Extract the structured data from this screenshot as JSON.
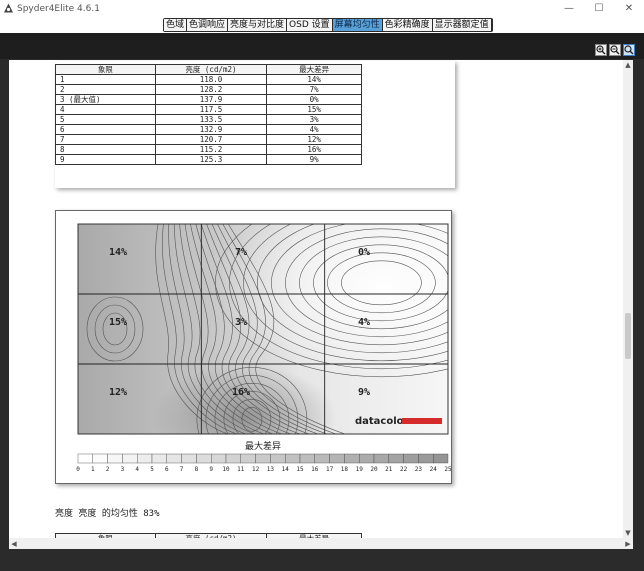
{
  "window": {
    "title": "Spyder4Elite 4.6.1",
    "minimize": "—",
    "maximize": "☐",
    "close": "✕"
  },
  "tabs": [
    {
      "label": "色域",
      "active": false
    },
    {
      "label": "色调响应",
      "active": false
    },
    {
      "label": "亮度与对比度",
      "active": false
    },
    {
      "label": "OSD 设置",
      "active": false
    },
    {
      "label": "屏幕均匀性",
      "active": true
    },
    {
      "label": "色彩精确度",
      "active": false
    },
    {
      "label": "显示器额定值",
      "active": false
    }
  ],
  "zoom": {
    "zoom_in": "zoom-in-icon",
    "zoom_out": "zoom-out-icon",
    "zoom_fit": "zoom-fit-icon"
  },
  "table1": {
    "headers": [
      "象限",
      "亮度 (cd/m2)",
      "最大差异"
    ],
    "rows": [
      [
        "1",
        "118.0",
        "14%"
      ],
      [
        "2",
        "128.2",
        "7%"
      ],
      [
        "3 (最大值)",
        "137.9",
        "0%"
      ],
      [
        "4",
        "117.5",
        "15%"
      ],
      [
        "5",
        "133.5",
        "3%"
      ],
      [
        "6",
        "132.9",
        "4%"
      ],
      [
        "7",
        "120.7",
        "12%"
      ],
      [
        "8",
        "115.2",
        "16%"
      ],
      [
        "9",
        "125.3",
        "9%"
      ]
    ]
  },
  "chart_data": {
    "type": "heatmap",
    "grid": "3x3",
    "cells": [
      "14%",
      "7%",
      "0%",
      "15%",
      "3%",
      "4%",
      "12%",
      "16%",
      "9%"
    ],
    "values": [
      14,
      7,
      0,
      15,
      3,
      4,
      12,
      16,
      9
    ],
    "xlabel": "最大差异",
    "scale_ticks": [
      "0",
      "1",
      "2",
      "3",
      "4",
      "5",
      "6",
      "7",
      "8",
      "9",
      "10",
      "11",
      "12",
      "13",
      "14",
      "15",
      "16",
      "17",
      "18",
      "19",
      "20",
      "21",
      "22",
      "23",
      "24",
      "25"
    ],
    "scale_range": [
      0,
      25
    ],
    "logo": "datacolor",
    "logo_color": "#d62b2b"
  },
  "uniformity_text": "亮度 亮度 的均匀性 83%",
  "table2": {
    "headers": [
      "象限",
      "亮度 (cd/m2)",
      "最大差异"
    ]
  }
}
